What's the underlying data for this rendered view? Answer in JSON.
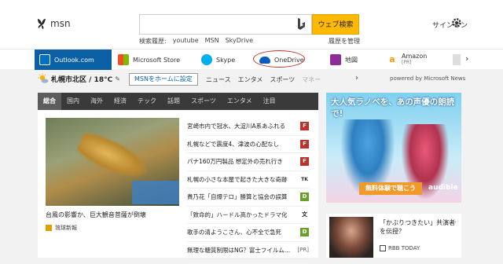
{
  "header": {
    "logo_text": "msn",
    "search_button": "ウェブ検索",
    "signin": "サインイン",
    "history_label": "検索履歴:",
    "history_items": [
      "youtube",
      "MSN",
      "SkyDrive"
    ],
    "history_manage": "履歴を管理"
  },
  "navbar": {
    "items": [
      {
        "label": "Outlook.com",
        "icon": "outlook-icon",
        "color": "#0072c6"
      },
      {
        "label": "Microsoft Store",
        "icon": "store-icon",
        "color": "#555555"
      },
      {
        "label": "Skype",
        "icon": "skype-icon",
        "color": "#00aff0"
      },
      {
        "label": "OneDrive",
        "icon": "onedrive-icon",
        "color": "#0a5bbd"
      },
      {
        "label": "地図",
        "icon": "map-icon",
        "color": "#8e2c9a"
      },
      {
        "label": "Amazon",
        "sub": "[PR]",
        "icon": "amazon-icon",
        "color": "#ff9900"
      }
    ]
  },
  "subbar": {
    "location": "札幌市北区 / 18°C",
    "sethome": "MSNをホームに設定",
    "items": [
      "ニュース",
      "エンタメ",
      "スポーツ",
      "マネー"
    ],
    "powered": "powered by Microsoft News"
  },
  "panel": {
    "tabs": [
      "総合",
      "国内",
      "海外",
      "経済",
      "テック",
      "話題",
      "スポーツ",
      "エンタメ",
      "注目"
    ],
    "hero_caption": "台風の影響か、巨大観音菩薩が倒壊",
    "hero_source": "琉球新報",
    "rows": [
      {
        "text": "宮崎市内で冠水、大淀川A系あふれる",
        "icon": "F",
        "color": "#c0302a"
      },
      {
        "text": "札幌などで震度4、津波の心配なし",
        "icon": "F",
        "color": "#c0302a"
      },
      {
        "text": "パナ160万円製品 想定外の売れ行き",
        "icon": "F",
        "color": "#c0302a"
      },
      {
        "text": "札幌の小さな本屋で起きた大きな奇跡",
        "icon": "TK",
        "color": "#222222"
      },
      {
        "text": "貴乃花「自爆テロ」勝算と協会の誤算",
        "icon": "D",
        "color": "#6aa02a"
      },
      {
        "text": "「致命的」ハードル高かったドラマ化",
        "icon": "文",
        "color": "#111111"
      },
      {
        "text": "歌手の清ようこさん、心不全で急死",
        "icon": "D",
        "color": "#6aa02a"
      },
      {
        "text": "無理な糖質制限はNG？富士フイルム…",
        "icon": "[PR]",
        "color": "#ffffff"
      }
    ]
  },
  "ad": {
    "title": "大人気ラノベを、あの声優の朗読で!",
    "cta": "無料体験で聴こう",
    "brand": "audible"
  },
  "card": {
    "title": "「かぶりつきたい」共演者を伝授？",
    "source": "RBB TODAY"
  }
}
